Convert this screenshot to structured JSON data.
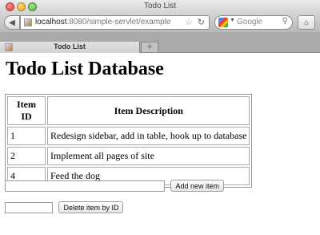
{
  "window": {
    "title": "Todo List"
  },
  "toolbar": {
    "url_host": "localhost",
    "url_path": ":8080/simple-servlet/example",
    "search_placeholder": "Google"
  },
  "tab": {
    "label": "Todo List"
  },
  "page": {
    "heading": "Todo List Database",
    "table": {
      "headers": [
        "Item ID",
        "Item Description"
      ],
      "rows": [
        {
          "id": "1",
          "description": "Redesign sidebar, add in table, hook up to database"
        },
        {
          "id": "2",
          "description": "Implement all pages of site"
        },
        {
          "id": "4",
          "description": "Feed the dog"
        }
      ]
    },
    "add_form": {
      "input_value": "",
      "button_label": "Add new item"
    },
    "delete_form": {
      "input_value": "",
      "button_label": "Delete item by ID"
    }
  }
}
